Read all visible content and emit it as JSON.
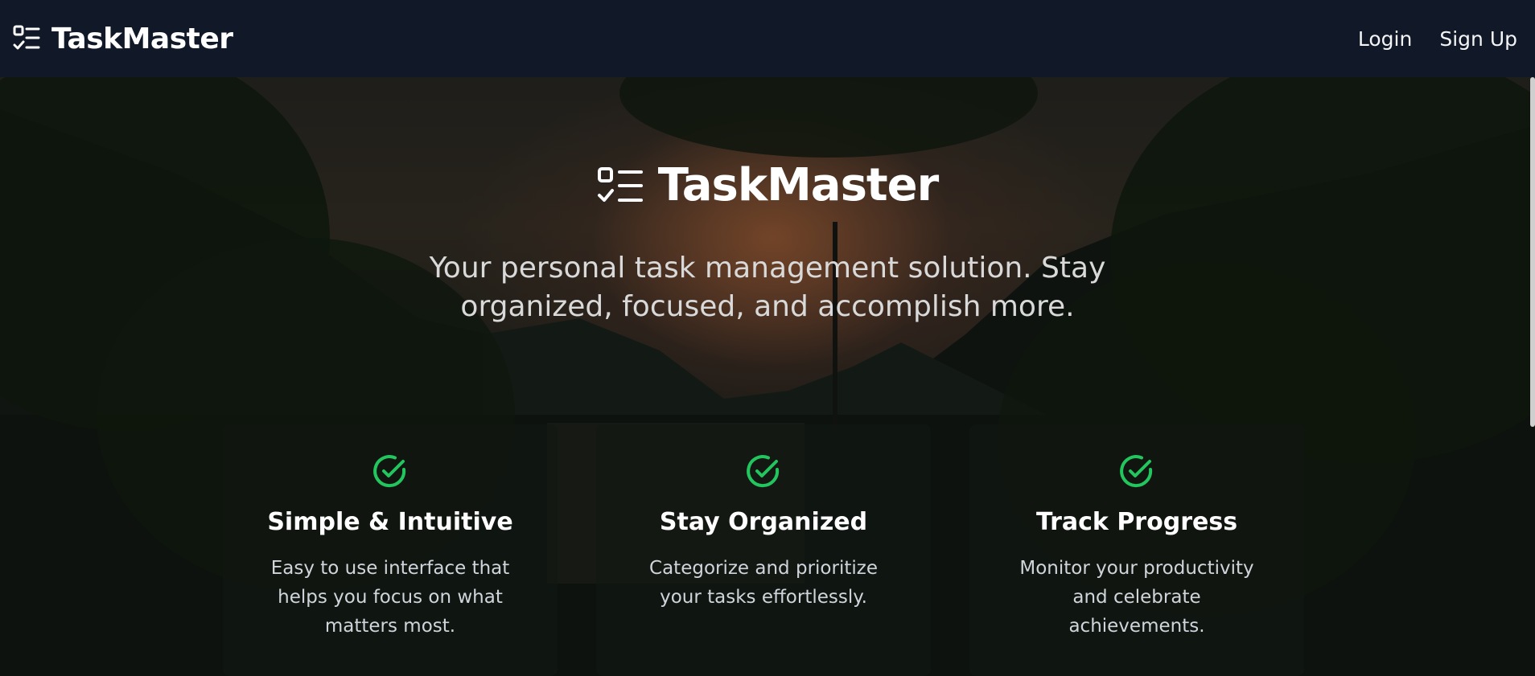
{
  "navbar": {
    "brand_name": "TaskMaster",
    "brand_icon": "checklist-icon",
    "links": [
      {
        "label": "Login"
      },
      {
        "label": "Sign Up"
      }
    ]
  },
  "hero": {
    "title": "TaskMaster",
    "title_icon": "checklist-icon",
    "subtitle": "Your personal task management solution. Stay organized, focused, and accomplish more."
  },
  "features": [
    {
      "icon": "check-circle-icon",
      "title": "Simple & Intuitive",
      "description": "Easy to use interface that helps you focus on what matters most."
    },
    {
      "icon": "check-circle-icon",
      "title": "Stay Organized",
      "description": "Categorize and prioritize your tasks effortlessly."
    },
    {
      "icon": "check-circle-icon",
      "title": "Track Progress",
      "description": "Monitor your productivity and celebrate achievements."
    }
  ],
  "colors": {
    "navbar_bg": "#111827",
    "accent_green": "#22c55e",
    "text_white": "#ffffff"
  }
}
